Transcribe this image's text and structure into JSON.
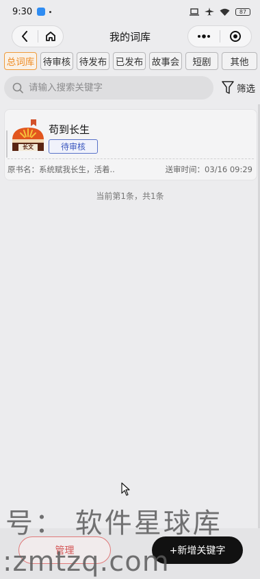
{
  "status_bar": {
    "time": "9:30",
    "battery": "87"
  },
  "nav": {
    "title": "我的词库"
  },
  "tabs": [
    {
      "label": "总词库",
      "active": true
    },
    {
      "label": "待审核",
      "active": false
    },
    {
      "label": "待发布",
      "active": false
    },
    {
      "label": "已发布",
      "active": false
    },
    {
      "label": "故事会",
      "active": false
    },
    {
      "label": "短剧",
      "active": false
    },
    {
      "label": "其他",
      "active": false
    }
  ],
  "search": {
    "placeholder": "请输入搜索关键字",
    "value": "",
    "filter_label": "筛选"
  },
  "items": [
    {
      "cover_tag": "长文",
      "title": "苟到长生",
      "status": "待审核",
      "original_title": "原书名：系统赋我长生，活着..",
      "submit_time": "送审时间：03/16 09:29"
    }
  ],
  "pagination_text": "当前第1条，共1条",
  "footer": {
    "manage_label": "管理",
    "add_label": "+新增关键字"
  },
  "watermark": {
    "line1": "号：  软件星球库",
    "line2": ":zmtzq.com"
  },
  "colors": {
    "accent": "#ee8a22",
    "badge": "#3b57bf",
    "danger": "#d45656"
  }
}
